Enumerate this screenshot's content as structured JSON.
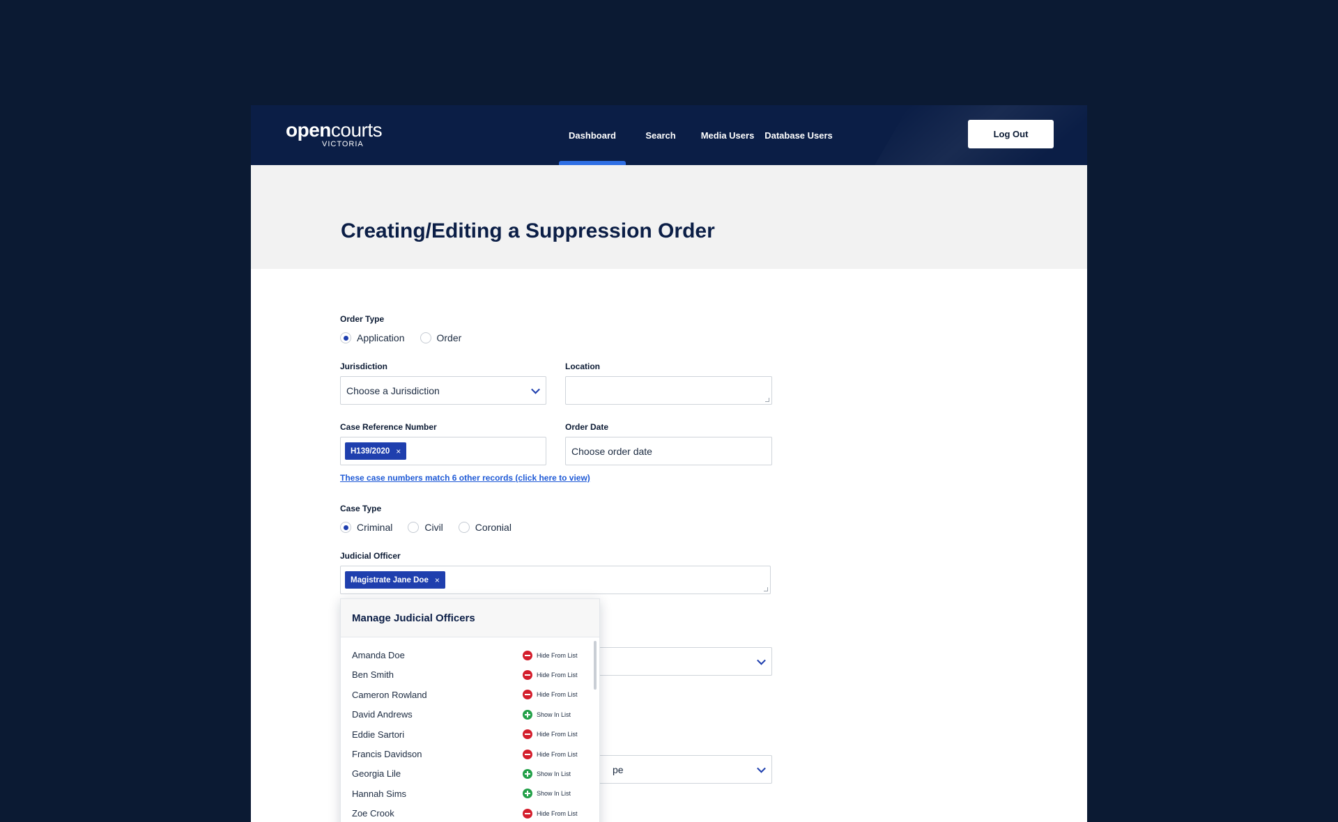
{
  "header": {
    "logo_bold": "open",
    "logo_light": "courts",
    "logo_sub": "VICTORIA",
    "nav": [
      "Dashboard",
      "Search",
      "Media Users",
      "Database Users"
    ],
    "active_nav": "Dashboard",
    "logout_label": "Log Out"
  },
  "page": {
    "title": "Creating/Editing a Suppression Order"
  },
  "form": {
    "order_type": {
      "label": "Order Type",
      "options": [
        "Application",
        "Order"
      ],
      "selected": "Application"
    },
    "jurisdiction": {
      "label": "Jurisdiction",
      "value": "Choose a Jurisdiction"
    },
    "location": {
      "label": "Location",
      "value": ""
    },
    "case_ref": {
      "label": "Case Reference Number",
      "chip": "H139/2020",
      "match_link": "These case numbers match 6 other records (click here to view)"
    },
    "order_date": {
      "label": "Order Date",
      "placeholder": "Choose order date"
    },
    "case_type": {
      "label": "Case Type",
      "options": [
        "Criminal",
        "Civil",
        "Coronial"
      ],
      "selected": "Criminal"
    },
    "judicial_officer": {
      "label": "Judicial Officer",
      "chip": "Magistrate Jane Doe"
    },
    "hidden_select_fragment": "pe",
    "chip_remove_glyph": "×"
  },
  "manage_popup": {
    "title": "Manage Judicial Officers",
    "hide_label": "Hide From List",
    "show_label": "Show In List",
    "officers": [
      {
        "name": "Amanda Doe",
        "action": "hide"
      },
      {
        "name": "Ben Smith",
        "action": "hide"
      },
      {
        "name": "Cameron Rowland",
        "action": "hide"
      },
      {
        "name": "David Andrews",
        "action": "show"
      },
      {
        "name": "Eddie Sartori",
        "action": "hide"
      },
      {
        "name": "Francis Davidson",
        "action": "hide"
      },
      {
        "name": "Georgia Lile",
        "action": "show"
      },
      {
        "name": "Hannah Sims",
        "action": "show"
      },
      {
        "name": "Zoe Crook",
        "action": "hide"
      }
    ]
  },
  "colors": {
    "background": "#0b1a33",
    "header": "#0b1e46",
    "accent": "#1f3fae",
    "active_underline": "#2f6fe4",
    "hide": "#d41e2c",
    "show": "#22a048"
  }
}
